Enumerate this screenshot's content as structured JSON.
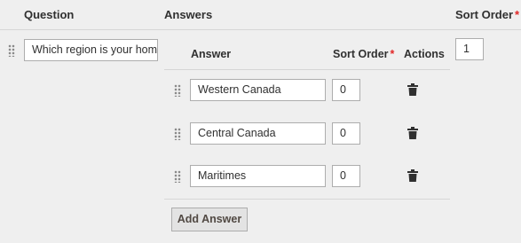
{
  "header": {
    "question": "Question",
    "answers": "Answers",
    "sort_order": "Sort Order",
    "required_mark": "*"
  },
  "question_row": {
    "question_value": "Which region is your home",
    "sort_order_value": "1"
  },
  "answers_table": {
    "col_answer": "Answer",
    "col_sort_order": "Sort Order",
    "col_actions": "Actions",
    "rows": [
      {
        "answer": "Western Canada",
        "sort_order": "0"
      },
      {
        "answer": "Central Canada",
        "sort_order": "0"
      },
      {
        "answer": "Maritimes",
        "sort_order": "0"
      }
    ]
  },
  "add_answer_label": "Add Answer",
  "icons": {
    "drag": "drag-handle-icon",
    "delete": "trash-icon"
  }
}
